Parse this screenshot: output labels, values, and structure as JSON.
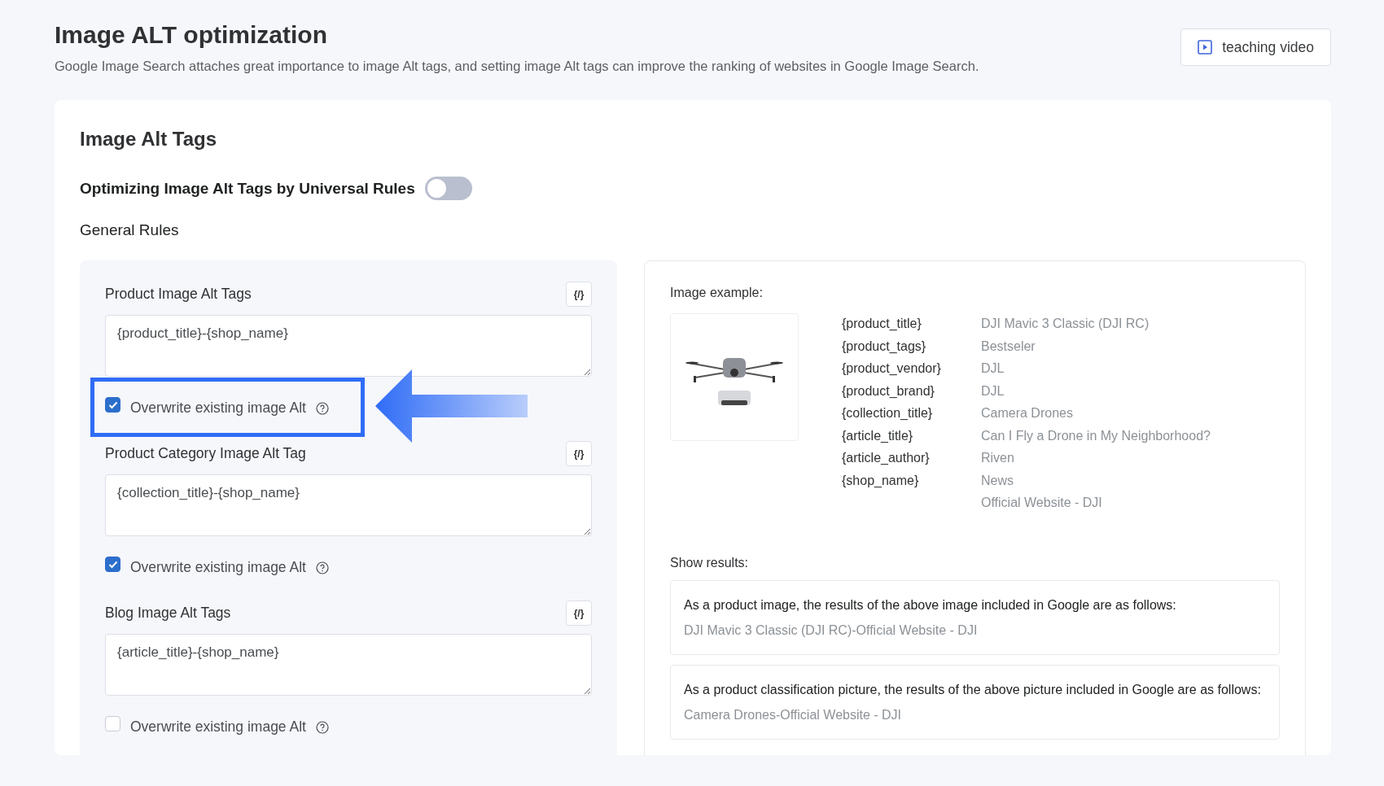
{
  "header": {
    "title": "Image ALT optimization",
    "description": "Google Image Search attaches great importance to image Alt tags, and setting image Alt tags can improve the ranking of websites in Google Image Search.",
    "video_button": "teaching video"
  },
  "card": {
    "title": "Image Alt Tags",
    "universal_rules": {
      "label": "Optimizing Image Alt Tags by Universal Rules",
      "on": false
    },
    "section_label": "General Rules"
  },
  "rules": [
    {
      "label": "Product Image Alt Tags",
      "variable_button": "{/}",
      "value": "{product_title}-{shop_name}",
      "overwrite": {
        "label": "Overwrite existing image Alt",
        "checked": true
      },
      "highlighted": true
    },
    {
      "label": "Product Category Image Alt Tag",
      "variable_button": "{/}",
      "value": "{collection_title}-{shop_name}",
      "overwrite": {
        "label": "Overwrite existing image Alt",
        "checked": true
      },
      "highlighted": false
    },
    {
      "label": "Blog Image Alt Tags",
      "variable_button": "{/}",
      "value": "{article_title}-{shop_name}",
      "overwrite": {
        "label": "Overwrite existing image Alt",
        "checked": false
      },
      "highlighted": false
    }
  ],
  "example": {
    "label": "Image example:",
    "variables": [
      {
        "key": "{product_title}",
        "value": "DJI Mavic 3 Classic (DJI RC)"
      },
      {
        "key": "{product_tags}",
        "value": "Bestseler"
      },
      {
        "key": "{product_vendor}",
        "value": "DJL"
      },
      {
        "key": "{product_brand}",
        "value": "DJL"
      },
      {
        "key": "{collection_title}",
        "value": "Camera Drones"
      },
      {
        "key": "{article_title}",
        "value": "Can I Fly a Drone in My Neighborhood?"
      },
      {
        "key": "{article_author}",
        "value": "Riven"
      },
      {
        "key": "{shop_name}",
        "value": "News"
      },
      {
        "value": "Official Website - DJI"
      }
    ],
    "results_label": "Show results:",
    "results": [
      {
        "text": "As a product image, the results of the above image included in Google are as follows:",
        "result": "DJI Mavic 3 Classic (DJI RC)-Official Website - DJI"
      },
      {
        "text": "As a product classification picture, the results of the above picture included in Google are as follows:",
        "result": "Camera Drones-Official Website - DJI"
      }
    ]
  }
}
